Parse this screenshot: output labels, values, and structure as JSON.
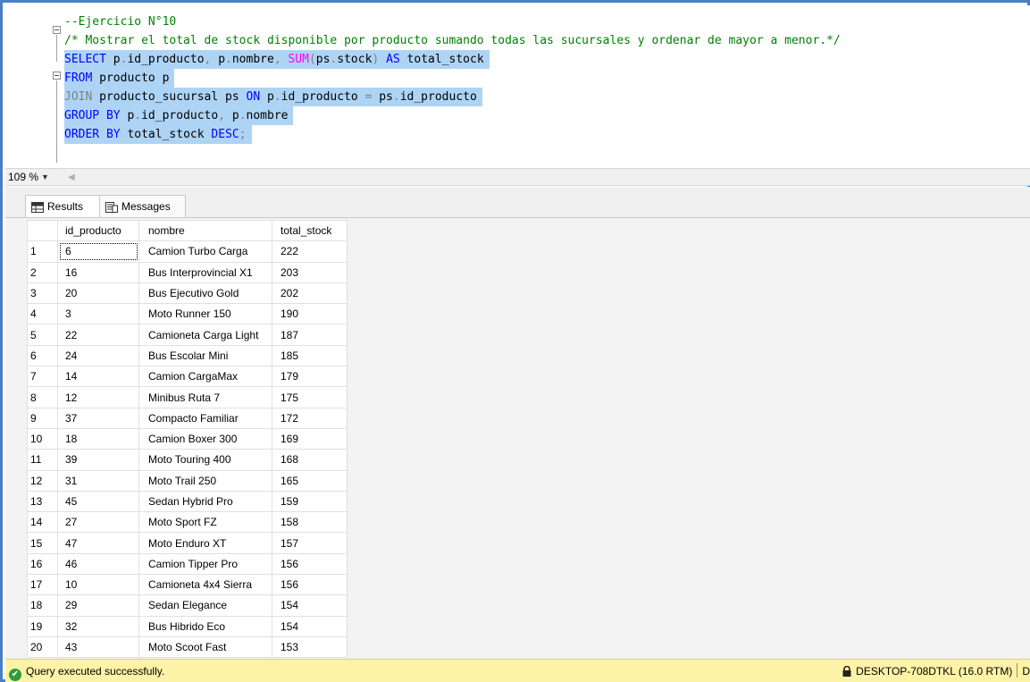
{
  "editor": {
    "lines": [
      {
        "segments": [
          {
            "t": "--Ejercicio N°10",
            "c": "cm"
          }
        ]
      },
      {
        "segments": [
          {
            "t": "/* Mostrar el total de stock disponible por producto sumando todas las sucursales y ordenar de mayor a menor.*/",
            "c": "cm"
          }
        ]
      },
      {
        "sel": true,
        "segments": [
          {
            "t": "SELECT",
            "c": "kw"
          },
          {
            "t": " p",
            "c": ""
          },
          {
            "t": ".",
            "c": "gr"
          },
          {
            "t": "id_producto",
            "c": ""
          },
          {
            "t": ", ",
            "c": "gr"
          },
          {
            "t": "p",
            "c": ""
          },
          {
            "t": ".",
            "c": "gr"
          },
          {
            "t": "nombre",
            "c": ""
          },
          {
            "t": ", ",
            "c": "gr"
          },
          {
            "t": "SUM",
            "c": "fn"
          },
          {
            "t": "(",
            "c": "gr"
          },
          {
            "t": "ps",
            "c": ""
          },
          {
            "t": ".",
            "c": "gr"
          },
          {
            "t": "stock",
            "c": ""
          },
          {
            "t": ")",
            "c": "gr"
          },
          {
            "t": " AS",
            "c": "kw"
          },
          {
            "t": " total_stock",
            "c": ""
          }
        ]
      },
      {
        "sel": true,
        "segments": [
          {
            "t": "FROM",
            "c": "kw"
          },
          {
            "t": " producto p",
            "c": ""
          }
        ]
      },
      {
        "sel": true,
        "segments": [
          {
            "t": "JOIN",
            "c": "gr"
          },
          {
            "t": " producto_sucursal ps ",
            "c": ""
          },
          {
            "t": "ON",
            "c": "kw"
          },
          {
            "t": " p",
            "c": ""
          },
          {
            "t": ".",
            "c": "gr"
          },
          {
            "t": "id_producto ",
            "c": ""
          },
          {
            "t": "=",
            "c": "gr"
          },
          {
            "t": " ps",
            "c": ""
          },
          {
            "t": ".",
            "c": "gr"
          },
          {
            "t": "id_producto",
            "c": ""
          }
        ]
      },
      {
        "sel": true,
        "segments": [
          {
            "t": "GROUP BY",
            "c": "kw"
          },
          {
            "t": " p",
            "c": ""
          },
          {
            "t": ".",
            "c": "gr"
          },
          {
            "t": "id_producto",
            "c": ""
          },
          {
            "t": ", ",
            "c": "gr"
          },
          {
            "t": "p",
            "c": ""
          },
          {
            "t": ".",
            "c": "gr"
          },
          {
            "t": "nombre",
            "c": ""
          }
        ]
      },
      {
        "sel": true,
        "segments": [
          {
            "t": "ORDER BY",
            "c": "kw"
          },
          {
            "t": " total_stock ",
            "c": ""
          },
          {
            "t": "DESC",
            "c": "kw"
          },
          {
            "t": ";",
            "c": "gr"
          }
        ]
      }
    ]
  },
  "zoom": {
    "level": "109 %"
  },
  "tabs": {
    "results": "Results",
    "messages": "Messages"
  },
  "grid": {
    "columns": [
      "id_producto",
      "nombre",
      "total_stock"
    ],
    "rows": [
      [
        "1",
        "6",
        "Camion Turbo Carga",
        "222"
      ],
      [
        "2",
        "16",
        "Bus Interprovincial X1",
        "203"
      ],
      [
        "3",
        "20",
        "Bus Ejecutivo Gold",
        "202"
      ],
      [
        "4",
        "3",
        "Moto Runner 150",
        "190"
      ],
      [
        "5",
        "22",
        "Camioneta Carga Light",
        "187"
      ],
      [
        "6",
        "24",
        "Bus Escolar Mini",
        "185"
      ],
      [
        "7",
        "14",
        "Camion CargaMax",
        "179"
      ],
      [
        "8",
        "12",
        "Minibus Ruta 7",
        "175"
      ],
      [
        "9",
        "37",
        "Compacto Familiar",
        "172"
      ],
      [
        "10",
        "18",
        "Camion Boxer 300",
        "169"
      ],
      [
        "11",
        "39",
        "Moto Touring 400",
        "168"
      ],
      [
        "12",
        "31",
        "Moto Trail 250",
        "165"
      ],
      [
        "13",
        "45",
        "Sedan Hybrid Pro",
        "159"
      ],
      [
        "14",
        "27",
        "Moto Sport FZ",
        "158"
      ],
      [
        "15",
        "47",
        "Moto Enduro XT",
        "157"
      ],
      [
        "16",
        "46",
        "Camion Tipper Pro",
        "156"
      ],
      [
        "17",
        "10",
        "Camioneta 4x4 Sierra",
        "156"
      ],
      [
        "18",
        "29",
        "Sedan Elegance",
        "154"
      ],
      [
        "19",
        "32",
        "Bus Hibrido Eco",
        "154"
      ],
      [
        "20",
        "43",
        "Moto Scoot Fast",
        "153"
      ]
    ]
  },
  "status": {
    "message": "Query executed successfully.",
    "server": "DESKTOP-708DTKL (16.0 RTM)",
    "next": "D"
  },
  "colors": {
    "keyword": "#0000ff",
    "function": "#ff00ff",
    "comment": "#008000",
    "selection": "#aed4f5",
    "status_bg": "#fdf3a7"
  }
}
